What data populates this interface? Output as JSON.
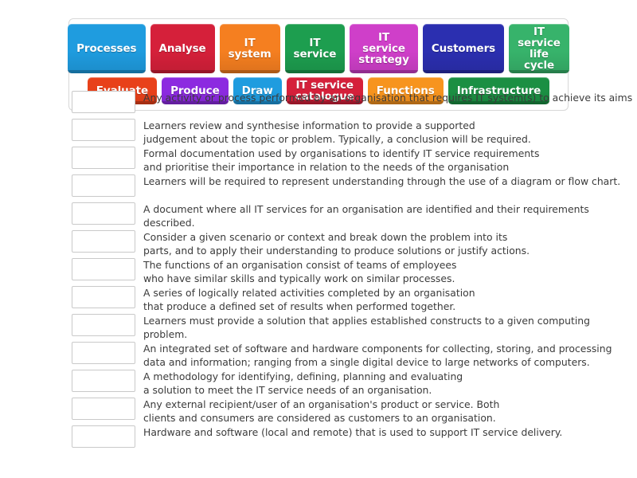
{
  "tile_bank": {
    "rows": [
      [
        {
          "label": "Processes",
          "color": "#1f9cdf"
        },
        {
          "label": "Analyse",
          "color": "#d5203a"
        },
        {
          "label": "IT system",
          "color": "#f57f20"
        },
        {
          "label": "IT service",
          "color": "#1d9e4f"
        },
        {
          "label": "IT service\nstrategy",
          "color": "#cf3fc9"
        },
        {
          "label": "Customers",
          "color": "#2b2fb0"
        },
        {
          "label": "IT service\nlife cycle",
          "color": "#37b36b"
        }
      ],
      [
        {
          "label": "Evaluate",
          "color": "#e8411a"
        },
        {
          "label": "Produce",
          "color": "#8c2ae0"
        },
        {
          "label": "Draw",
          "color": "#1f9cdf"
        },
        {
          "label": "IT service\ncatalogue",
          "color": "#d5203a"
        },
        {
          "label": "Functions",
          "color": "#f7941e"
        },
        {
          "label": "Infrastructure",
          "color": "#1b8f43"
        }
      ]
    ]
  },
  "definitions": [
    {
      "text": "Any activity or process performed by an organisation that requires IT system(s) to achieve its aims"
    },
    {
      "text": "Learners review and synthesise information to provide a supported\njudgement about the topic or problem. Typically, a conclusion will be required."
    },
    {
      "text": "Formal documentation used by organisations to identify IT service requirements\nand prioritise their importance in relation to the needs of the organisation"
    },
    {
      "text": "Learners will be required to represent understanding through the use of a diagram or flow chart."
    },
    {
      "text": "A document where all IT services for an organisation are identified and their requirements described."
    },
    {
      "text": "Consider a given scenario or context and break down the problem into its\nparts, and to apply their understanding to produce solutions or justify actions."
    },
    {
      "text": "The functions of an organisation consist of teams of employees\nwho have similar skills and typically work on similar processes."
    },
    {
      "text": "A series of logically related activities completed by an organisation\nthat produce a defined set of results when performed together."
    },
    {
      "text": "Learners must provide a solution that applies established constructs to a given computing problem."
    },
    {
      "text": "An integrated set of software and hardware components for collecting, storing, and processing\ndata and information; ranging from a single digital device to large networks of computers."
    },
    {
      "text": "A methodology for identifying, defining, planning and evaluating\na solution to meet the IT service needs of an organisation."
    },
    {
      "text": "Any external recipient/user of an organisation's product or service. Both\nclients and consumers are considered as customers to an organisation."
    },
    {
      "text": "Hardware and software (local and remote) that is used to support IT service delivery."
    }
  ]
}
